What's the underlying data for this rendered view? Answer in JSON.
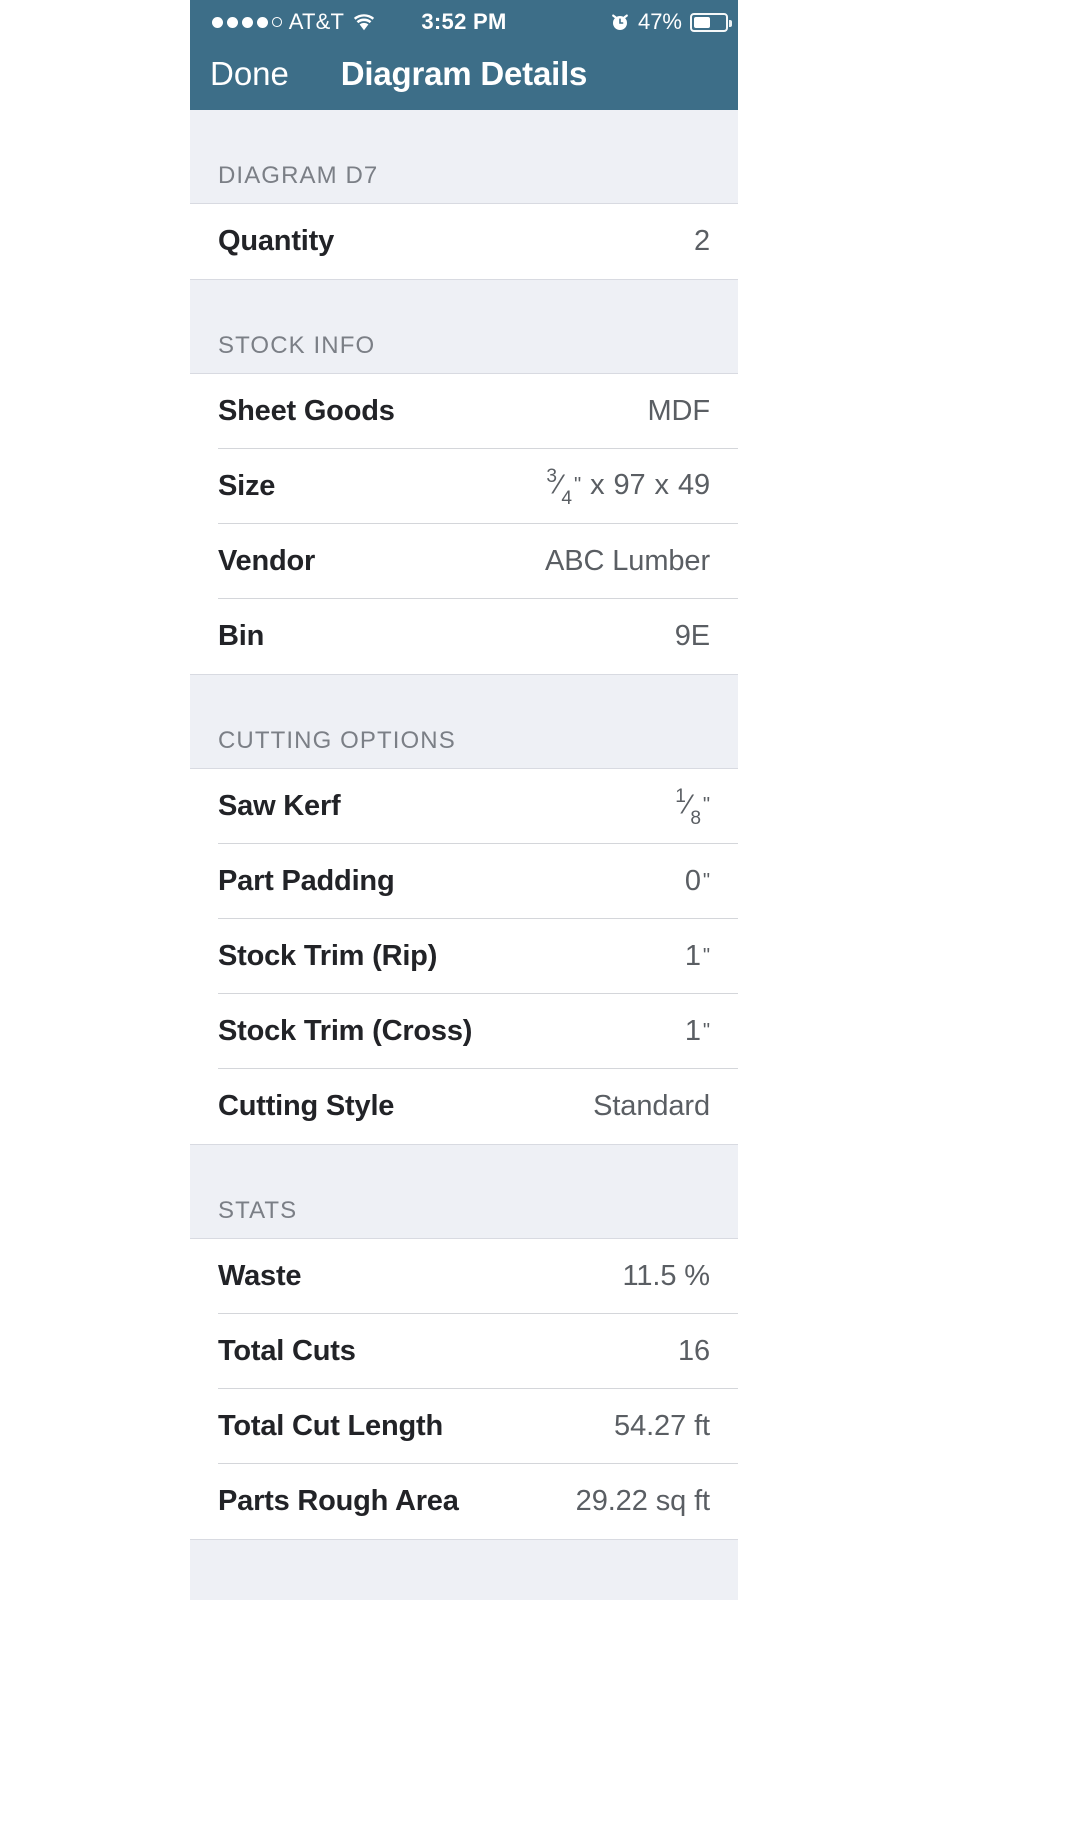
{
  "statusbar": {
    "signal_dots_filled": 4,
    "signal_dots_total": 5,
    "carrier": "AT&T",
    "wifi_icon": "wifi-icon",
    "time": "3:52 PM",
    "alarm_icon": "alarm-clock-icon",
    "battery_percent": "47%",
    "battery_level": 47
  },
  "navbar": {
    "done_label": "Done",
    "title": "Diagram Details"
  },
  "theme": {
    "header_bg": "#3d6e88",
    "section_bg": "#eef0f5",
    "row_bg": "#ffffff",
    "label_color": "#222327",
    "value_color": "#5a5e63",
    "separator_color": "#d4d6da"
  },
  "sections": [
    {
      "title": "DIAGRAM D7",
      "rows": [
        {
          "label": "Quantity",
          "value": "2"
        }
      ]
    },
    {
      "title": "STOCK INFO",
      "rows": [
        {
          "label": "Sheet Goods",
          "value": "MDF"
        },
        {
          "label": "Size",
          "value_parts": {
            "fraction_num": "3",
            "fraction_den": "4",
            "unit": "\"",
            "sep1": "x",
            "dim2": "97",
            "sep2": "x",
            "dim3": "49"
          },
          "value_text": "3/4\" x 97 x 49"
        },
        {
          "label": "Vendor",
          "value": "ABC Lumber"
        },
        {
          "label": "Bin",
          "value": "9E"
        }
      ]
    },
    {
      "title": "CUTTING OPTIONS",
      "rows": [
        {
          "label": "Saw Kerf",
          "value_parts": {
            "fraction_num": "1",
            "fraction_den": "8",
            "unit": "\""
          },
          "value_text": "1/8\""
        },
        {
          "label": "Part Padding",
          "value_parts": {
            "whole": "0",
            "unit": "\""
          },
          "value_text": "0\""
        },
        {
          "label": "Stock Trim (Rip)",
          "value_parts": {
            "whole": "1",
            "unit": "\""
          },
          "value_text": "1\""
        },
        {
          "label": "Stock Trim (Cross)",
          "value_parts": {
            "whole": "1",
            "unit": "\""
          },
          "value_text": "1\""
        },
        {
          "label": "Cutting Style",
          "value": "Standard"
        }
      ]
    },
    {
      "title": "STATS",
      "rows": [
        {
          "label": "Waste",
          "value": "11.5 %"
        },
        {
          "label": "Total Cuts",
          "value": "16"
        },
        {
          "label": "Total Cut Length",
          "value": "54.27 ft"
        },
        {
          "label": "Parts Rough Area",
          "value": "29.22 sq ft"
        }
      ]
    }
  ]
}
